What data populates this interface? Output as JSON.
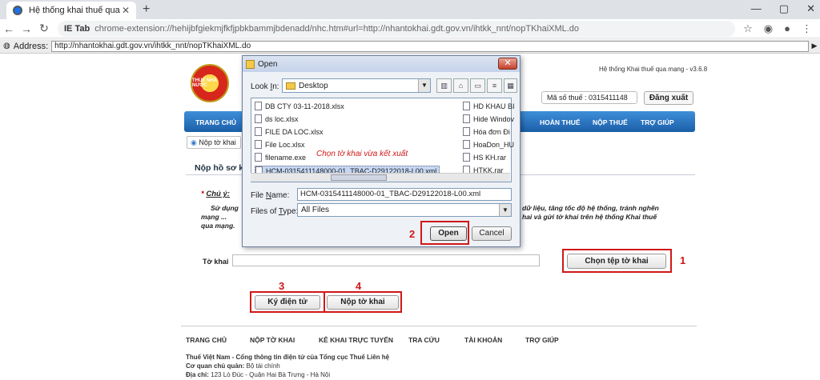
{
  "browser": {
    "tab_title": "Hệ thống khai thuế qua mạng",
    "tab_close": "✕",
    "new_tab": "+",
    "window_controls": [
      "—",
      "▢",
      "✕"
    ],
    "back": "←",
    "forward": "→",
    "reload": "↻",
    "ie_tab_label": "IE Tab",
    "url": "chrome-extension://hehijbfgiekmjfkfjpbkbammjbdenadd/nhc.htm#url=http://nhantokhai.gdt.gov.vn/ihtkk_nnt/nopTKhaiXML.do",
    "address_label": "Address:",
    "address_value": "http://nhantokhai.gdt.gov.vn/ihtkk_nnt/nopTKhaiXML.do",
    "go": "▶"
  },
  "header": {
    "logo_text": "THUẾ NHÀ NƯỚC",
    "system_version": "Hệ thống Khai thuế qua mạng - v3.6.8",
    "tax_code_label": "Mã số thuế :",
    "tax_code_value": "0315411148",
    "logout": "Đăng xuất"
  },
  "menu": {
    "items": [
      "TRANG CHỦ",
      "HOÀN THUẾ",
      "NỘP THUẾ",
      "TRỢ GIÚP"
    ]
  },
  "breadcrumb": "Nộp tờ khai",
  "section_title": "Nộp hồ sơ k",
  "note": {
    "label": "Chú ý:",
    "line1a": "Sử dụng",
    "line1b": "dữ liệu, tăng tốc độ hệ thống, tránh nghẽn",
    "line2a": "mạng ...",
    "line2b": "hai và gửi tờ khai trên hệ thống Khai thuế",
    "line3": "qua mạng."
  },
  "form": {
    "tokhai_label": "Tờ khai",
    "choose_file": "Chọn tệp tờ khai",
    "sign": "Ký điện tử",
    "submit": "Nộp tờ khai"
  },
  "annotations": {
    "n1": "1",
    "n2": "2",
    "n3": "3",
    "n4": "4",
    "hint": "Chọn tờ khai vừa kết xuất"
  },
  "footer": {
    "menu": [
      "TRANG CHỦ",
      "NỘP TỜ KHAI",
      "KÊ KHAI TRỰC TUYẾN",
      "TRA CỨU",
      "TÀI KHOẢN",
      "TRỢ GIÚP"
    ],
    "line1": "Thuế Việt Nam - Cổng thông tin điện tử của Tổng cục Thuế Liên hệ",
    "line2_label": "Cơ quan chủ quản:",
    "line2_value": "Bộ tài chính",
    "line3_label": "Địa chỉ:",
    "line3_value": "123 Lò Đúc - Quận Hai Bà Trưng - Hà Nội"
  },
  "dialog": {
    "title": "Open",
    "close": "✕",
    "look_in_label_pre": "Look ",
    "look_in_label_key": "I",
    "look_in_label_post": "n:",
    "look_in_value": "Desktop",
    "dropdown_arrow": "▼",
    "toolbar_icons": [
      "⌂",
      "▭",
      "≡",
      "▦"
    ],
    "files_col1": [
      "DB  CTY 03-11-2018.xlsx",
      "ds loc.xlsx",
      "FILE DA LOC.xlsx",
      "File Loc.xlsx",
      "filename.exe",
      "HCM-0315411148000-01_TBAC-D29122018-L00.xml"
    ],
    "files_col2": [
      "HD KHAU BI",
      "Hide Windov",
      "Hóa đơn Đi",
      "HoaDon_HU",
      "HS KH.rar",
      "HTKK.rar"
    ],
    "file_name_label_pre": "File ",
    "file_name_label_key": "N",
    "file_name_label_post": "ame:",
    "file_name_value": "HCM-0315411148000-01_TBAC-D29122018-L00.xml",
    "file_type_label_pre": "Files of ",
    "file_type_label_key": "T",
    "file_type_label_post": "ype:",
    "file_type_value": "All Files",
    "open": "Open",
    "cancel": "Cancel"
  }
}
